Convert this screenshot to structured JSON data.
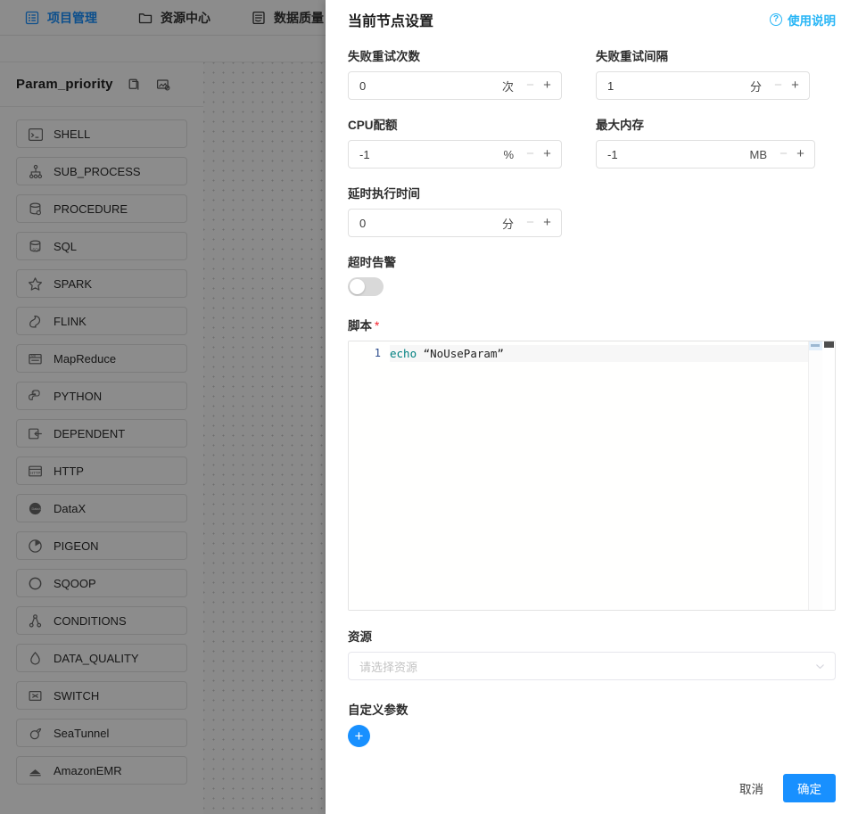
{
  "topnav": {
    "items": [
      {
        "label": "项目管理",
        "icon": "project-icon",
        "active": true
      },
      {
        "label": "资源中心",
        "icon": "folder-icon",
        "active": false
      },
      {
        "label": "数据质量",
        "icon": "data-quality-icon",
        "active": false
      }
    ]
  },
  "sidebar": {
    "workflow_name": "Param_priority",
    "header_icons": [
      "copy-icon",
      "edit-image-icon"
    ],
    "task_types": [
      {
        "label": "SHELL",
        "icon": "terminal-icon"
      },
      {
        "label": "SUB_PROCESS",
        "icon": "hierarchy-icon"
      },
      {
        "label": "PROCEDURE",
        "icon": "database-gear-icon"
      },
      {
        "label": "SQL",
        "icon": "database-sql-icon"
      },
      {
        "label": "SPARK",
        "icon": "star-icon"
      },
      {
        "label": "FLINK",
        "icon": "squirrel-icon"
      },
      {
        "label": "MapReduce",
        "icon": "mapreduce-icon"
      },
      {
        "label": "PYTHON",
        "icon": "python-icon"
      },
      {
        "label": "DEPENDENT",
        "icon": "dependent-icon"
      },
      {
        "label": "HTTP",
        "icon": "http-icon"
      },
      {
        "label": "DataX",
        "icon": "datax-icon"
      },
      {
        "label": "PIGEON",
        "icon": "pigeon-icon"
      },
      {
        "label": "SQOOP",
        "icon": "sqoop-icon"
      },
      {
        "label": "CONDITIONS",
        "icon": "conditions-icon"
      },
      {
        "label": "DATA_QUALITY",
        "icon": "droplet-icon"
      },
      {
        "label": "SWITCH",
        "icon": "switch-icon"
      },
      {
        "label": "SeaTunnel",
        "icon": "seatunnel-icon"
      },
      {
        "label": "AmazonEMR",
        "icon": "cloud-icon"
      }
    ]
  },
  "drawer": {
    "title": "当前节点设置",
    "help_label": "使用说明",
    "help_icon": "question-circle-icon",
    "fields": {
      "retry_times": {
        "label": "失败重试次数",
        "value": "0",
        "unit": "次"
      },
      "retry_interval": {
        "label": "失败重试间隔",
        "value": "1",
        "unit": "分"
      },
      "cpu_quota": {
        "label": "CPU配额",
        "value": "-1",
        "unit": "%"
      },
      "max_memory": {
        "label": "最大内存",
        "value": "-1",
        "unit": "MB"
      },
      "delay_time": {
        "label": "延时执行时间",
        "value": "0",
        "unit": "分"
      },
      "timeout_alarm": {
        "label": "超时告警",
        "enabled": false
      },
      "script": {
        "label": "脚本",
        "required_mark": "*",
        "line_number": "1",
        "code_keyword": "echo",
        "code_string": " “NoUseParam”"
      },
      "resource": {
        "label": "资源",
        "placeholder": "请选择资源",
        "value": ""
      },
      "custom_params": {
        "label": "自定义参数",
        "add_label": "+"
      }
    },
    "footer": {
      "cancel_label": "取消",
      "confirm_label": "确定"
    }
  },
  "colors": {
    "accent": "#1890ff",
    "help_link": "#29b6f6",
    "required": "#f5222d",
    "keyword": "#008080"
  }
}
